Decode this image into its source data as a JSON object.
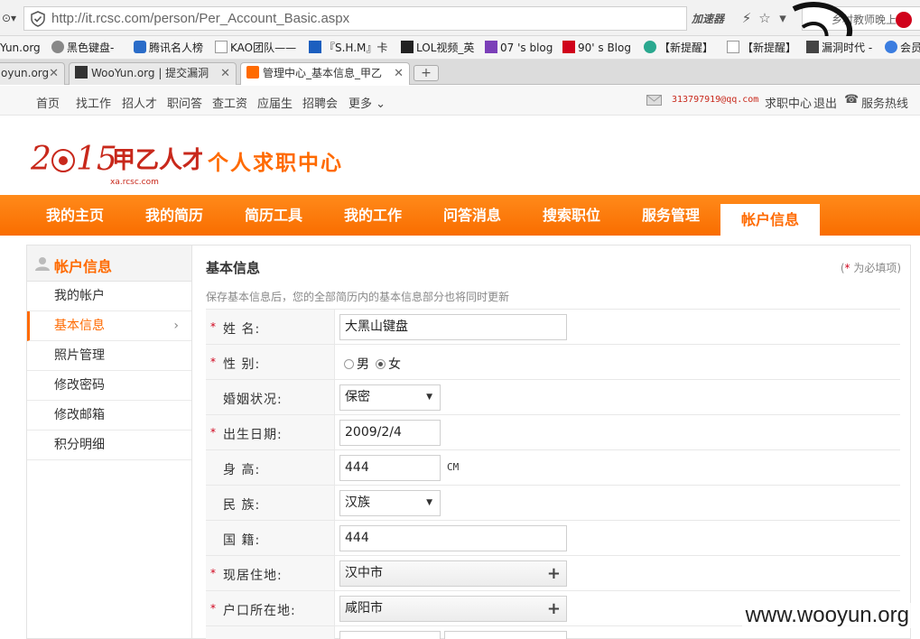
{
  "browser": {
    "url": "http://it.rcsc.com/person/Per_Account_Basic.aspx",
    "accelerator_label": "加速器",
    "search_text": "乡村教师晚上搬",
    "bookmarks": [
      "Yun.org",
      "黑色键盘-",
      "腾讯名人榜",
      "KAO团队——",
      "『S.H.M』卡",
      "LOL视频_英",
      "07 's blog",
      "90' s Blog",
      "【新提醒】",
      "【新提醒】",
      "漏洞时代 -",
      "会员"
    ],
    "tabs": [
      {
        "label": "oyun.org"
      },
      {
        "label": "WooYun.org | 提交漏洞"
      },
      {
        "label": "管理中心_基本信息_甲乙"
      }
    ],
    "new_tab_label": "+"
  },
  "site_top": {
    "links": [
      "首页",
      "找工作",
      "招人才",
      "职问答",
      "查工资",
      "应届生",
      "招聘会",
      "更多"
    ],
    "email": "313797919@qq.com",
    "center_link": "求职中心",
    "logout": "退出",
    "hotline": "服务热线"
  },
  "header": {
    "logo_text": "2015甲乙人才网",
    "logo_domain": "xa.rcsc.com",
    "center_title": "个人求职中心"
  },
  "main_nav": {
    "items": [
      "我的主页",
      "我的简历",
      "简历工具",
      "我的工作",
      "问答消息",
      "搜索职位",
      "服务管理",
      "帐户信息"
    ],
    "active": "帐户信息"
  },
  "sidebar": {
    "title": "帐户信息",
    "items": [
      "我的帐户",
      "基本信息",
      "照片管理",
      "修改密码",
      "修改邮箱",
      "积分明细"
    ],
    "active": "基本信息"
  },
  "panel": {
    "title": "基本信息",
    "required_note_star": "*",
    "required_note_text": " 为必填项)",
    "required_note_open": "(",
    "tip": "保存基本信息后，您的全部简历内的基本信息部分也将同时更新"
  },
  "form": {
    "name_label": "姓  名:",
    "name_value": "大黑山键盘",
    "gender_label": "性  别:",
    "gender_male": "男",
    "gender_female": "女",
    "gender_selected": "女",
    "marital_label": "婚姻状况:",
    "marital_value": "保密",
    "birth_label": "出生日期:",
    "birth_value": "2009/2/4",
    "height_label": "身  高:",
    "height_value": "444",
    "height_unit": "CM",
    "ethnic_label": "民  族:",
    "ethnic_value": "汉族",
    "nationality_label": "国  籍:",
    "nationality_value": "444",
    "residence_label": "现居住地:",
    "residence_value": "汉中市",
    "hukou_label": "户口所在地:",
    "hukou_value": "咸阳市",
    "required_star": "*"
  },
  "watermark": "www.wooyun.org",
  "colors": {
    "accent": "#ff6a00",
    "nav_bg": "#f96d00",
    "required": "#d0021b"
  }
}
